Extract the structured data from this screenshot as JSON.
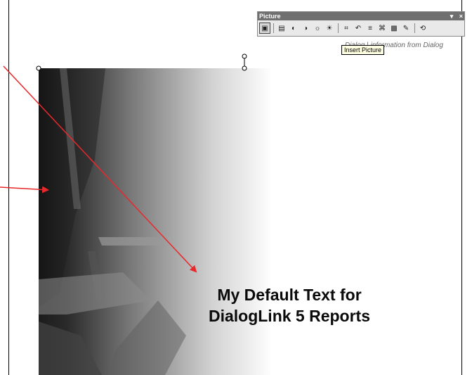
{
  "toolbar": {
    "title": "Picture",
    "controls": {
      "dropdown": "▾",
      "close": "×"
    },
    "tooltip": "Insert Picture",
    "buttons": [
      {
        "name": "insert-picture-icon",
        "glyph": "▣"
      },
      {
        "name": "color-icon",
        "glyph": "▤"
      },
      {
        "name": "more-contrast-icon",
        "glyph": "◐"
      },
      {
        "name": "less-contrast-icon",
        "glyph": "◑"
      },
      {
        "name": "more-brightness-icon",
        "glyph": "☼"
      },
      {
        "name": "less-brightness-icon",
        "glyph": "☀"
      },
      {
        "name": "crop-icon",
        "glyph": "⌗"
      },
      {
        "name": "rotate-left-icon",
        "glyph": "↶"
      },
      {
        "name": "line-style-icon",
        "glyph": "≡"
      },
      {
        "name": "compress-pictures-icon",
        "glyph": "⌘"
      },
      {
        "name": "format-picture-icon",
        "glyph": "▩"
      },
      {
        "name": "set-transparent-color-icon",
        "glyph": "✎"
      },
      {
        "name": "reset-picture-icon",
        "glyph": "⟲"
      }
    ]
  },
  "background_text": "Dialog | information from Dialog",
  "report_text": {
    "line1": "My Default Text for",
    "line2": "DialogLink 5 Reports"
  },
  "colors": {
    "arrow": "#e8282b"
  }
}
